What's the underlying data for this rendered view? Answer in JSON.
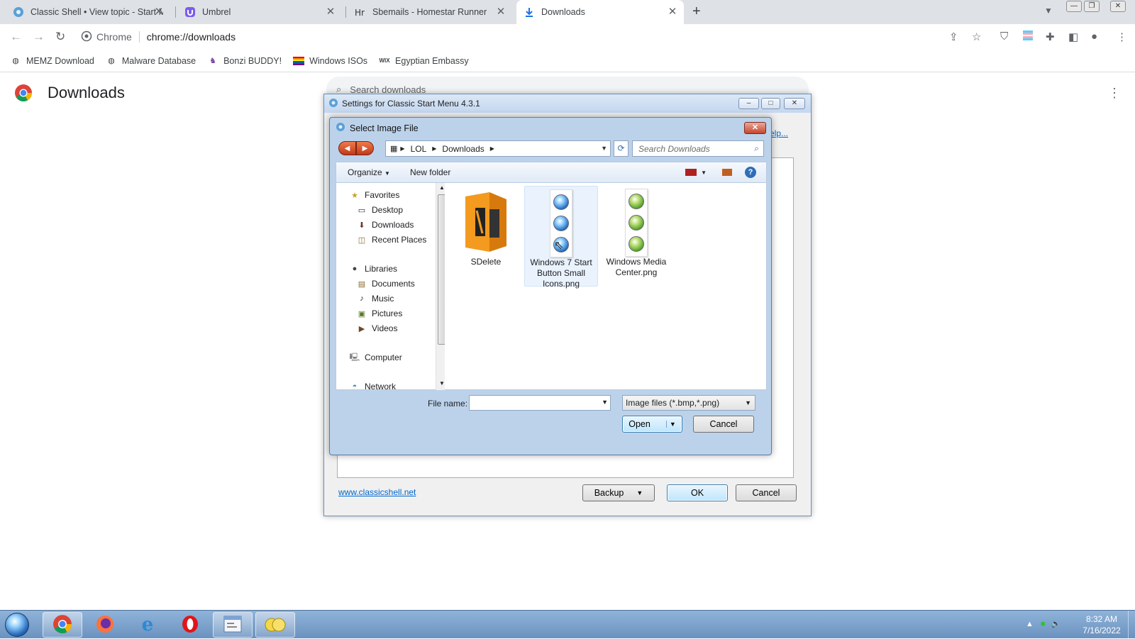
{
  "browser": {
    "tabs": [
      {
        "title": "Classic Shell • View topic - Start M",
        "active": false
      },
      {
        "title": "Umbrel",
        "active": false
      },
      {
        "title": "Sbemails - Homestar Runner",
        "active": false
      },
      {
        "title": "Downloads",
        "active": true
      }
    ],
    "site_label": "Chrome",
    "url": "chrome://downloads",
    "bookmarks": [
      {
        "label": "MEMZ Download",
        "icon": "globe-icon"
      },
      {
        "label": "Malware Database",
        "icon": "globe-icon"
      },
      {
        "label": "Bonzi BUDDY!",
        "icon": "bonzi-icon"
      },
      {
        "label": "Windows ISOs",
        "icon": "rainbow-flag-icon"
      },
      {
        "label": "Egyptian Embassy",
        "icon": "wix-icon"
      }
    ]
  },
  "downloads_page": {
    "title": "Downloads",
    "search_placeholder": "Search downloads"
  },
  "settings_dialog": {
    "title": "Settings for Classic Start Menu 4.3.1",
    "help_link_fragment": "elp...",
    "website_link": "www.classicshell.net",
    "backup_label": "Backup",
    "ok_label": "OK",
    "cancel_label": "Cancel"
  },
  "file_picker": {
    "title": "Select Image File",
    "breadcrumb": [
      "LOL",
      "Downloads"
    ],
    "search_placeholder": "Search Downloads",
    "organize_label": "Organize",
    "new_folder_label": "New folder",
    "nav_pane": {
      "favorites": {
        "label": "Favorites",
        "items": [
          "Desktop",
          "Downloads",
          "Recent Places"
        ]
      },
      "libraries": {
        "label": "Libraries",
        "items": [
          "Documents",
          "Music",
          "Pictures",
          "Videos"
        ]
      },
      "computer": "Computer",
      "network": "Network"
    },
    "files": [
      {
        "name": "SDelete",
        "type": "folder",
        "selected": false
      },
      {
        "name": "Windows 7 Start Button Small Icons.png",
        "type": "png",
        "selected": true
      },
      {
        "name": "Windows Media Center.png",
        "type": "png",
        "selected": false
      }
    ],
    "file_name_label": "File name:",
    "file_name_value": "",
    "file_type": "Image files (*.bmp,*.png)",
    "open_label": "Open",
    "cancel_label": "Cancel"
  },
  "taskbar": {
    "apps": [
      "chrome",
      "firefox",
      "internet-explorer",
      "opera",
      "classic-shell-settings",
      "explorer"
    ],
    "time": "8:32 AM",
    "date": "7/16/2022"
  },
  "colors": {
    "tab_strip": "#dee1e6",
    "aero_title": "#c4d7ef",
    "taskbar": "#6b92c0",
    "link": "#0066cc"
  }
}
